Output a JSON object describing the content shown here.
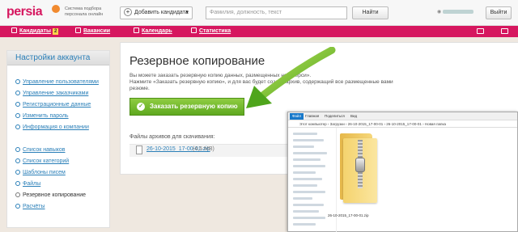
{
  "header": {
    "logo": "persia",
    "tagline": "Система подбора персонала онлайн",
    "add_candidate": "Добавить кандидата",
    "search_placeholder": "Фамилия, должность, текст",
    "find_button": "Найти",
    "exit_button": "Выйти"
  },
  "nav": {
    "items": [
      {
        "label": "Кандидаты",
        "badge": "2"
      },
      {
        "label": "Вакансии"
      },
      {
        "label": "Календарь"
      },
      {
        "label": "Статистика"
      }
    ]
  },
  "sidebar": {
    "title": "Настройки аккаунта",
    "group1": [
      "Управление пользователями",
      "Управление заказчиками",
      "Регистрационные данные",
      "Изменить пароль",
      "Информация о компании"
    ],
    "group2": [
      "Список навыков",
      "Список категорий",
      "Шаблоны писем",
      "Файлы",
      "Резервное копирование",
      "Расчёты"
    ],
    "active": "Резервное копирование"
  },
  "main": {
    "title": "Резервное копирование",
    "desc_line1": "Вы можете заказать резервную копию данных, размещенных на «Перси».",
    "desc_line2": "Нажмите «Заказать резервную копию», и для вас будет создан архив, содержащий все размещенные вами резюме.",
    "order_button": "Заказать резервную копию",
    "files_label": "Файлы архивов для скачивания:",
    "file_name": "26-10-2015_17-00-01.zip",
    "file_size": "(4,5 MB)"
  },
  "explorer": {
    "tabs": [
      "Файл",
      "Главная",
      "Поделиться",
      "Вид"
    ],
    "address": "Этот компьютер › Загрузки › 26-10-2015_17-00-01 › 26-10-2015_17-00-01 › Новая папка",
    "folder_name": "26-10-2015_17-00-01.zip"
  },
  "colors": {
    "brand": "#d6175f",
    "button_green": "#5ea81f",
    "link": "#2a7fb8"
  }
}
